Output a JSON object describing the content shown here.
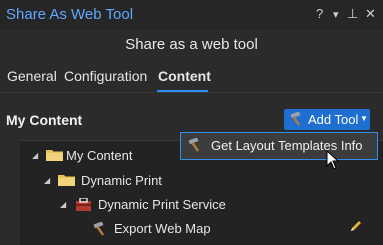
{
  "window": {
    "title": "Share As Web Tool",
    "help_glyph": "?",
    "menu_glyph": "▾",
    "pin_glyph": "⊥",
    "close_glyph": "✕"
  },
  "header": {
    "subtitle": "Share as a web tool"
  },
  "tabs": [
    {
      "label": "General",
      "active": false
    },
    {
      "label": "Configuration",
      "active": false
    },
    {
      "label": "Content",
      "active": true
    }
  ],
  "content": {
    "section_title": "My Content",
    "add_tool_label": "Add Tool",
    "dropdown_item": "Get Layout Templates Info",
    "tree": [
      {
        "label": "My Content",
        "icon": "folder-icon",
        "expanded": true
      },
      {
        "label": "Dynamic Print",
        "icon": "folder-icon",
        "expanded": true
      },
      {
        "label": "Dynamic Print Service",
        "icon": "toolbox-icon",
        "expanded": true
      },
      {
        "label": "Export Web Map",
        "icon": "hammer-icon"
      }
    ]
  },
  "colors": {
    "accent": "#2f8fef",
    "title": "#5fa8ff",
    "button": "#1f6fd1",
    "background": "#2b2b2b"
  }
}
